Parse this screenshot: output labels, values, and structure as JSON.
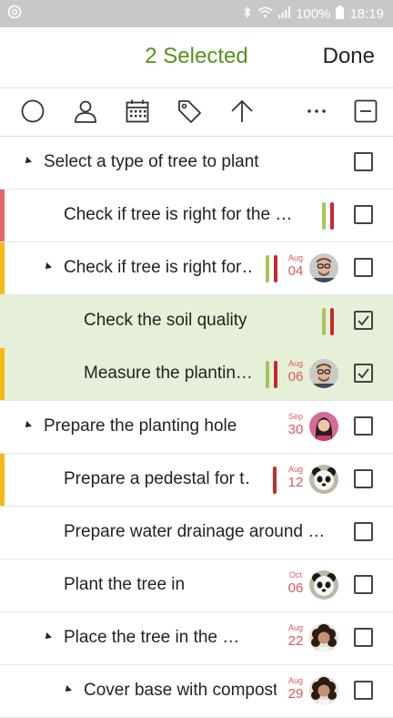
{
  "status_bar": {
    "battery": "100%",
    "time": "18:19",
    "icons": [
      "app-notification-icon",
      "bluetooth-icon",
      "wifi-icon",
      "signal-icon",
      "battery-icon"
    ]
  },
  "header": {
    "title": "2 Selected",
    "done_label": "Done"
  },
  "toolbar": {
    "icons": [
      "circle-status-icon",
      "assign-user-icon",
      "calendar-icon",
      "tag-icon",
      "move-up-icon",
      "more-icon",
      "deselect-all-icon"
    ]
  },
  "colors": {
    "accent": "#5c8f1e",
    "selected_row": "#e6f0d8",
    "priority_red": "#e8656a",
    "priority_yellow": "#f5b914",
    "bar_green": "#a6c45a",
    "bar_red": "#c62a2f",
    "date_red": "#e0575b"
  },
  "tasks": [
    {
      "label": "Select a type of tree to plant",
      "indent": 0,
      "expandable": true,
      "priority": "none",
      "bars": [],
      "date_month": "",
      "date_day": "",
      "avatar": "",
      "checked": false,
      "selected": false
    },
    {
      "label": "Check if tree is right for the …",
      "indent": 1,
      "expandable": false,
      "priority": "red",
      "bars": [
        "green",
        "red"
      ],
      "date_month": "",
      "date_day": "",
      "avatar": "",
      "checked": false,
      "selected": false
    },
    {
      "label": "Check if tree is right for…",
      "indent": 1,
      "expandable": true,
      "priority": "yellow",
      "bars": [
        "green",
        "red"
      ],
      "date_month": "Aug",
      "date_day": "04",
      "avatar": "man-glasses",
      "checked": false,
      "selected": false
    },
    {
      "label": "Check the soil quality",
      "indent": 2,
      "expandable": false,
      "priority": "none",
      "bars": [
        "green",
        "red"
      ],
      "date_month": "",
      "date_day": "",
      "avatar": "",
      "checked": true,
      "selected": true
    },
    {
      "label": "Measure the plantin…",
      "indent": 2,
      "expandable": false,
      "priority": "yellow",
      "bars": [
        "green",
        "red"
      ],
      "date_month": "Aug",
      "date_day": "06",
      "avatar": "man-glasses",
      "checked": true,
      "selected": true
    },
    {
      "label": "Prepare the planting hole",
      "indent": 0,
      "expandable": true,
      "priority": "none",
      "bars": [],
      "date_month": "Sep",
      "date_day": "30",
      "avatar": "woman-pink",
      "checked": false,
      "selected": false
    },
    {
      "label": "Prepare a pedestal for t…",
      "indent": 1,
      "expandable": false,
      "priority": "yellow",
      "bars": [
        "red"
      ],
      "date_month": "Aug",
      "date_day": "12",
      "avatar": "panda",
      "checked": false,
      "selected": false
    },
    {
      "label": "Prepare water drainage around …",
      "indent": 1,
      "expandable": false,
      "priority": "none",
      "bars": [],
      "date_month": "",
      "date_day": "",
      "avatar": "",
      "checked": false,
      "selected": false
    },
    {
      "label": "Plant the tree in",
      "indent": 1,
      "expandable": false,
      "priority": "none",
      "bars": [],
      "date_month": "Oct",
      "date_day": "06",
      "avatar": "panda",
      "checked": false,
      "selected": false
    },
    {
      "label": "Place the tree in the …",
      "indent": 1,
      "expandable": true,
      "priority": "none",
      "bars": [],
      "date_month": "Aug",
      "date_day": "22",
      "avatar": "woman-curly",
      "checked": false,
      "selected": false
    },
    {
      "label": "Cover base with compost",
      "indent": 2,
      "expandable": true,
      "priority": "none",
      "bars": [],
      "date_month": "Aug",
      "date_day": "29",
      "avatar": "woman-curly",
      "checked": false,
      "selected": false
    }
  ]
}
